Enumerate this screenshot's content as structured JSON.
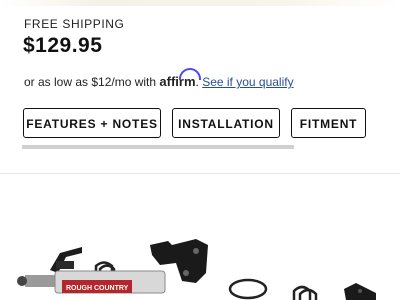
{
  "shipping_label": "FREE SHIPPING",
  "price": "$129.95",
  "financing": {
    "prefix": "or as low as $12/mo with",
    "brand": "affirm",
    "link_text": "See if you qualify"
  },
  "tabs": [
    {
      "label": "FEATURES + NOTES"
    },
    {
      "label": "INSTALLATION"
    },
    {
      "label": "FITMENT"
    }
  ],
  "product_image": {
    "brand_text": "ROUGH COUNTRY",
    "alt": "steering stabilizer kit parts"
  },
  "colors": {
    "accent_link": "#2a4d9b",
    "affirm_blue": "#4a4af4",
    "brand_red": "#b3262b"
  }
}
